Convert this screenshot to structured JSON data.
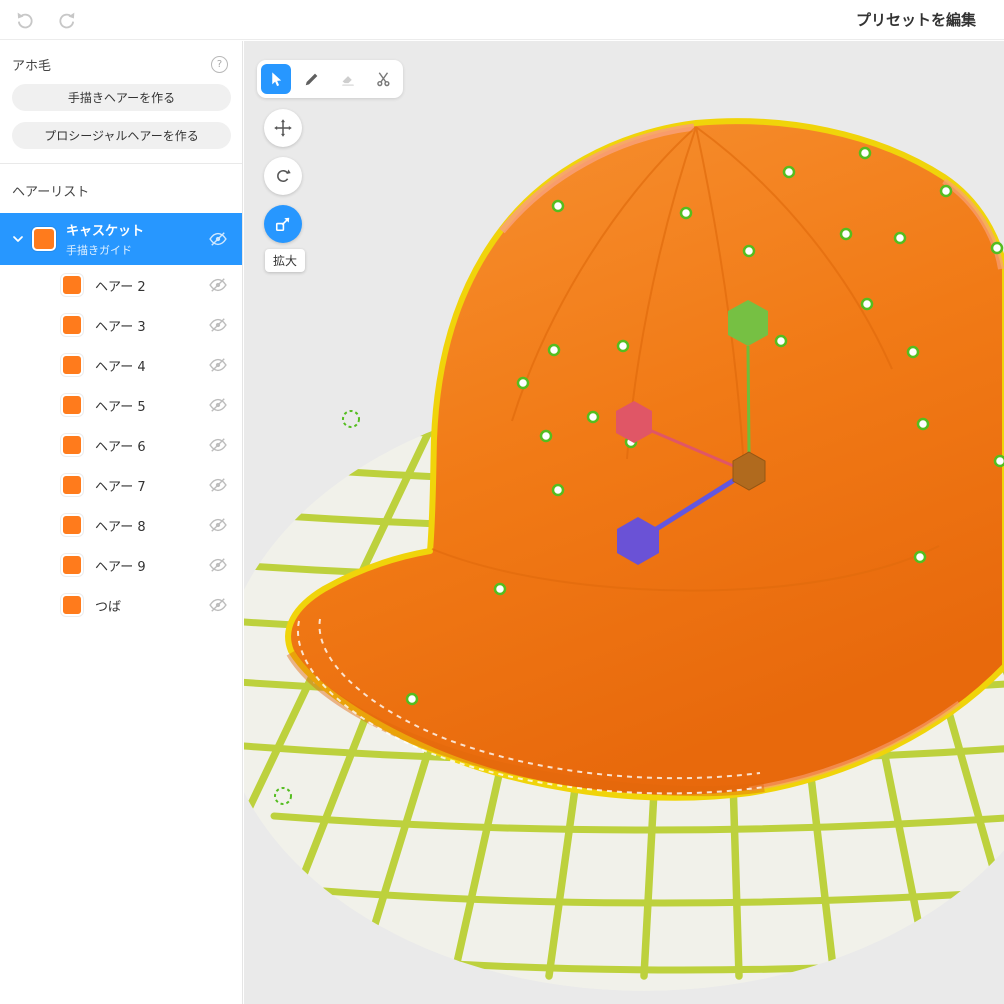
{
  "topbar": {
    "title": "プリセットを編集"
  },
  "sidebar": {
    "section_label": "アホ毛",
    "help_icon": "?",
    "buttons": [
      {
        "label": "手描きヘアーを作る"
      },
      {
        "label": "プロシージャルヘアーを作る"
      }
    ],
    "list_label": "ヘアーリスト",
    "group": {
      "title": "キャスケット",
      "subtitle": "手描きガイド"
    },
    "items": [
      {
        "label": "ヘアー 2"
      },
      {
        "label": "ヘアー 3"
      },
      {
        "label": "ヘアー 4"
      },
      {
        "label": "ヘアー 5"
      },
      {
        "label": "ヘアー 6"
      },
      {
        "label": "ヘアー 7"
      },
      {
        "label": "ヘアー 8"
      },
      {
        "label": "ヘアー 9"
      },
      {
        "label": "つば"
      }
    ]
  },
  "viewport": {
    "tooltip": "拡大",
    "tools": [
      "select",
      "pen",
      "eraser",
      "cut"
    ],
    "transform_tools": [
      "move",
      "rotate",
      "scale"
    ],
    "active_tool": "select",
    "active_transform": "scale"
  },
  "colors": {
    "accent_blue": "#2797ff",
    "swatch_orange": "#ff7b1c",
    "hat_orange": "#f17a16",
    "hat_outline_yellow": "#f0d40a",
    "grid_green": "#bdd13d",
    "handle_green": "#76c043",
    "handle_red": "#e05666",
    "handle_purple": "#6a52d6",
    "handle_center_brown": "#b06a1e",
    "control_point_green": "#54bd1f"
  }
}
